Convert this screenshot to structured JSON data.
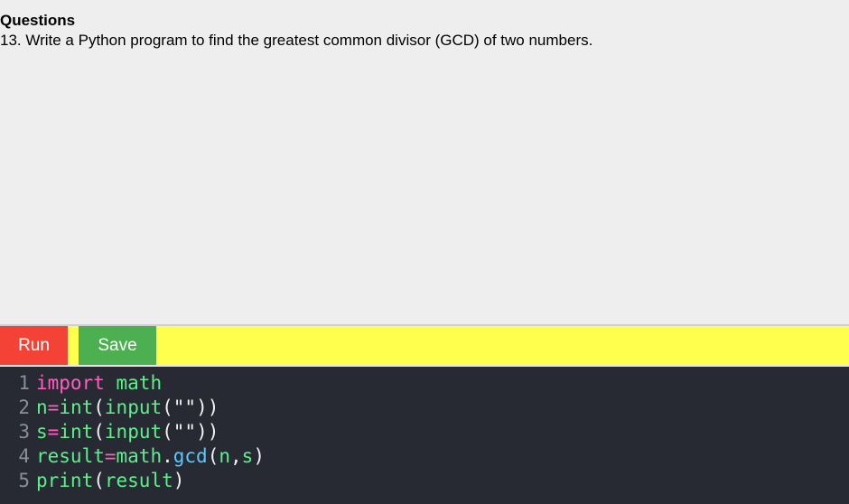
{
  "questions": {
    "heading": "Questions",
    "text": "13. Write a Python program to find the greatest common divisor (GCD) of two numbers."
  },
  "toolbar": {
    "run_label": "Run",
    "save_label": "Save"
  },
  "editor": {
    "lines": [
      {
        "number": "1",
        "tokens": [
          [
            "import",
            "kw"
          ],
          [
            " ",
            "punc"
          ],
          [
            "math",
            "id"
          ]
        ]
      },
      {
        "number": "2",
        "tokens": [
          [
            "n",
            "id"
          ],
          [
            "=",
            "op"
          ],
          [
            "int",
            "id"
          ],
          [
            "(",
            "punc"
          ],
          [
            "input",
            "id"
          ],
          [
            "(",
            "punc"
          ],
          [
            "\"\"",
            "str"
          ],
          [
            "))",
            "punc"
          ]
        ]
      },
      {
        "number": "3",
        "tokens": [
          [
            "s",
            "id"
          ],
          [
            "=",
            "op"
          ],
          [
            "int",
            "id"
          ],
          [
            "(",
            "punc"
          ],
          [
            "input",
            "id"
          ],
          [
            "(",
            "punc"
          ],
          [
            "\"\"",
            "str"
          ],
          [
            "))",
            "punc"
          ]
        ]
      },
      {
        "number": "4",
        "tokens": [
          [
            "result",
            "id"
          ],
          [
            "=",
            "op"
          ],
          [
            "math",
            "id"
          ],
          [
            ".",
            "punc"
          ],
          [
            "gcd",
            "fn"
          ],
          [
            "(",
            "punc"
          ],
          [
            "n",
            "id"
          ],
          [
            ",",
            "punc"
          ],
          [
            "s",
            "id"
          ],
          [
            ")",
            "punc"
          ]
        ]
      },
      {
        "number": "5",
        "tokens": [
          [
            "print",
            "id"
          ],
          [
            "(",
            "punc"
          ],
          [
            "result",
            "id"
          ],
          [
            ")",
            "punc"
          ]
        ]
      }
    ]
  },
  "colors": {
    "run_button": "#f44336",
    "save_button": "#4caf50",
    "toolbar_background": "#ffff4d",
    "editor_background": "#272a33"
  }
}
